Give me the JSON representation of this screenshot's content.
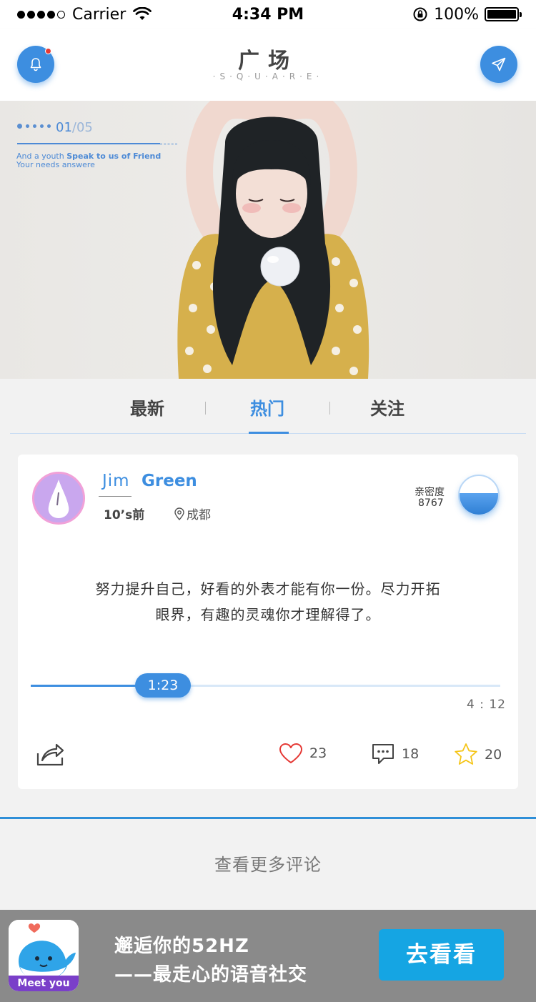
{
  "status_bar": {
    "carrier": "Carrier",
    "time": "4:34 PM",
    "battery": "100%",
    "battery_level": 1.0,
    "signal_bars_filled": 4,
    "signal_bars_total": 5
  },
  "header": {
    "title": "广场",
    "subtitle": "·S·Q·U·A·R·E·",
    "bell_icon": "bell-icon",
    "send_icon": "paper-plane-icon",
    "has_notification": true
  },
  "banner": {
    "current": "01",
    "separator": "/",
    "total": "05",
    "tagline_prefix": "And a youth ",
    "tagline_bold": "Speak to us of Friend",
    "tagline_line2": "Your  needs answere"
  },
  "tabs": [
    {
      "label": "最新",
      "active": false
    },
    {
      "label": "热门",
      "active": true
    },
    {
      "label": "关注",
      "active": false
    }
  ],
  "post": {
    "user_first": "Jim",
    "user_last": "Green",
    "time": "10’s前",
    "location": "成都",
    "intimacy_label": "亲密度",
    "intimacy_value": "8767",
    "intimacy_level": 0.55,
    "text": "努力提升自己，好看的外表才能有你一份。尽力开拓眼界，有趣的灵魂你才理解得了。",
    "player": {
      "current": "1:23",
      "total": "4 : 12",
      "progress": 0.33
    },
    "likes": "23",
    "comments": "18",
    "favorites": "20"
  },
  "more_comments": "查看更多评论",
  "promo": {
    "app_label": "Meet you",
    "line1": "邂逅你的52HZ",
    "line2": "——最走心的语音社交",
    "button": "去看看"
  },
  "colors": {
    "accent": "#3d8ee0",
    "promo_button": "#15a5e3",
    "promo_bar": "#8a8a8a",
    "like_red": "#e53935",
    "star_yellow": "#f5c518"
  }
}
